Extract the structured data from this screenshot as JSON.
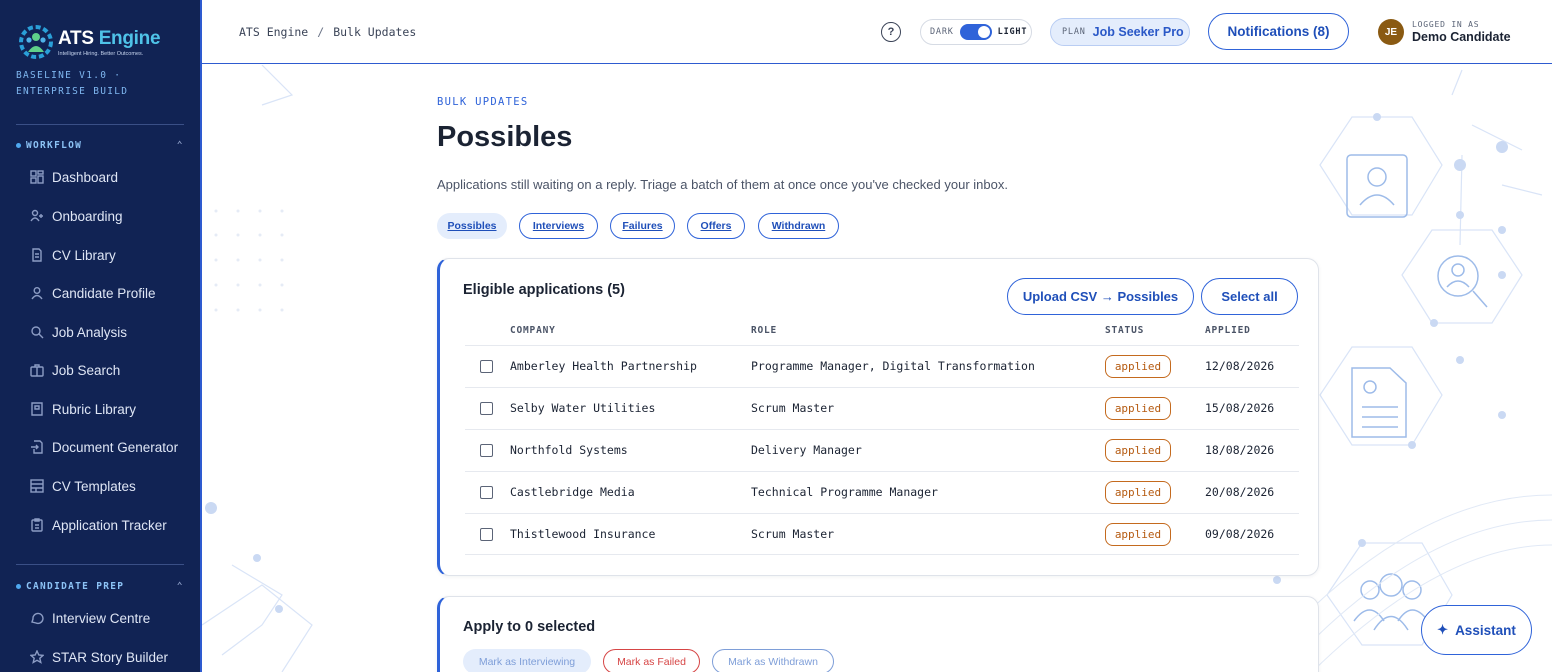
{
  "sidebar": {
    "brand_name_main": "ATS",
    "brand_name_accent": "Engine",
    "brand_tagline": "Intelligent Hiring. Better Outcomes.",
    "build": "BASELINE V1.0 · ENTERPRISE BUILD",
    "sections": [
      {
        "title": "WORKFLOW",
        "items": [
          {
            "label": "Dashboard",
            "icon": "dashboard-icon"
          },
          {
            "label": "Onboarding",
            "icon": "user-plus-icon"
          },
          {
            "label": "CV Library",
            "icon": "document-icon"
          },
          {
            "label": "Candidate Profile",
            "icon": "user-icon"
          },
          {
            "label": "Job Analysis",
            "icon": "search-icon"
          },
          {
            "label": "Job Search",
            "icon": "briefcase-icon"
          },
          {
            "label": "Rubric Library",
            "icon": "book-icon"
          },
          {
            "label": "Document Generator",
            "icon": "file-arrow-icon"
          },
          {
            "label": "CV Templates",
            "icon": "template-icon"
          },
          {
            "label": "Application Tracker",
            "icon": "clipboard-icon"
          }
        ]
      },
      {
        "title": "CANDIDATE PREP",
        "items": [
          {
            "label": "Interview Centre",
            "icon": "chat-icon"
          },
          {
            "label": "STAR Story Builder",
            "icon": "star-icon"
          }
        ]
      }
    ]
  },
  "header": {
    "breadcrumb_root": "ATS Engine",
    "breadcrumb_sep": "/",
    "breadcrumb_current": "Bulk Updates",
    "help": "?",
    "theme_dark": "DARK",
    "theme_light": "LIGHT",
    "plan_label": "PLAN",
    "plan_value": "Job Seeker Pro",
    "notifications": "Notifications (8)",
    "user_initials": "JE",
    "user_label": "LOGGED IN AS",
    "user_name": "Demo Candidate"
  },
  "main": {
    "eyebrow": "BULK UPDATES",
    "title": "Possibles",
    "subtitle": "Applications still waiting on a reply. Triage a batch of them at once once you've checked your inbox.",
    "tabs": [
      "Possibles",
      "Interviews",
      "Failures",
      "Offers",
      "Withdrawn"
    ],
    "active_tab": "Possibles",
    "eligible": {
      "title": "Eligible applications (5)",
      "upload_button": "Upload CSV → Possibles",
      "select_all_button": "Select all",
      "columns": [
        "COMPANY",
        "ROLE",
        "STATUS",
        "APPLIED"
      ],
      "rows": [
        {
          "company": "Amberley Health Partnership",
          "role": "Programme Manager, Digital Transformation",
          "status": "applied",
          "applied": "12/08/2026"
        },
        {
          "company": "Selby Water Utilities",
          "role": "Scrum Master",
          "status": "applied",
          "applied": "15/08/2026"
        },
        {
          "company": "Northfold Systems",
          "role": "Delivery Manager",
          "status": "applied",
          "applied": "18/08/2026"
        },
        {
          "company": "Castlebridge Media",
          "role": "Technical Programme Manager",
          "status": "applied",
          "applied": "20/08/2026"
        },
        {
          "company": "Thistlewood Insurance",
          "role": "Scrum Master",
          "status": "applied",
          "applied": "09/08/2026"
        }
      ]
    },
    "apply": {
      "title": "Apply to 0 selected",
      "mark_interviewing": "Mark as Interviewing",
      "mark_failed": "Mark as Failed",
      "mark_withdrawn": "Mark as Withdrawn"
    }
  },
  "assistant": {
    "label": "Assistant",
    "icon": "sparkle-icon"
  },
  "colors": {
    "sidebar_bg": "#112354",
    "accent": "#2f63d9",
    "status_applied": "#c46a1e",
    "danger": "#d64545"
  }
}
